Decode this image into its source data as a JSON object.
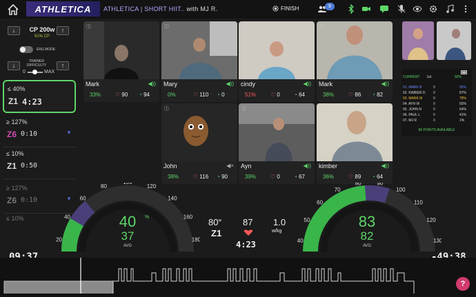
{
  "topbar": {
    "logo": "ATHLETICA",
    "class_title": "ATHLETICA | SHORT HIIT..",
    "instructor": "with MJ R.",
    "finish_label": "FINISH",
    "participant_count": "9"
  },
  "controls": {
    "cp_value": "CP 200w",
    "cp_percent": "91% CP",
    "erg_mode": "ERG MODE",
    "trainer_difficulty": "TRAINER DIFFICULTY",
    "min_label": "0",
    "max_label": "MAX"
  },
  "segments": [
    {
      "pct": "≤ 40%",
      "zone": "Z1",
      "time": "4:23"
    },
    {
      "pct": "≥ 127%",
      "zone": "Z6",
      "time": "0:10"
    },
    {
      "pct": "≤ 10%",
      "zone": "Z1",
      "time": "0:50"
    },
    {
      "pct": "≥ 127%",
      "zone": "Z6",
      "time": "0:10"
    },
    {
      "pct": "≤ 10%",
      "zone": "",
      "time": ""
    }
  ],
  "tiles": [
    {
      "name": "Mark",
      "pct": "33%",
      "hr": "90",
      "cad": "94"
    },
    {
      "name": "Mary",
      "pct": "0%",
      "hr": "110",
      "cad": "0"
    },
    {
      "name": "cindy",
      "pct": "51%",
      "hr": "0",
      "cad": "64"
    },
    {
      "name": "Mark",
      "pct": "38%",
      "hr": "86",
      "cad": "82"
    },
    {
      "name": "John",
      "pct": "38%",
      "hr": "116",
      "cad": "90"
    },
    {
      "name": "Ayn",
      "pct": "39%",
      "hr": "0",
      "cad": "67"
    },
    {
      "name": "kimber",
      "pct": "36%",
      "hr": "89",
      "cad": "64"
    }
  ],
  "leaderboard": {
    "current_label": "CURRENT",
    "place": "1st",
    "pct_label": "92%",
    "rows": [
      {
        "name": "01. MARK B",
        "val": "0",
        "pct": "92%"
      },
      {
        "name": "02. KIMBER D",
        "val": "0",
        "pct": "87%"
      },
      {
        "name": "03. MARK M",
        "val": "0",
        "pct": "78%"
      },
      {
        "name": "04. AYN W",
        "val": "0",
        "pct": "65%"
      },
      {
        "name": "05. JOHN N",
        "val": "0",
        "pct": "64%"
      },
      {
        "name": "06. PAUL L",
        "val": "0",
        "pct": "41%"
      },
      {
        "name": "07. MJ R",
        "val": "0",
        "pct": "1%"
      }
    ],
    "footer": "90 POINTS AVAILABLE"
  },
  "power_gauge": {
    "ticks": [
      "20",
      "40",
      "60",
      "80",
      "100",
      "120",
      "140",
      "160",
      "180"
    ],
    "current": "40",
    "unit": "%",
    "avg": "37",
    "avg_label": "AVG",
    "level_percent": 40
  },
  "cadence_gauge": {
    "ticks": [
      "40",
      "50",
      "60",
      "70",
      "80",
      "90",
      "100",
      "110",
      "120",
      "130"
    ],
    "current": "83",
    "avg": "82",
    "avg_label": "AVG",
    "level_rpm": 83
  },
  "middle": {
    "power": "80",
    "power_unit": "w",
    "zone": "Z1",
    "hr": "87",
    "wkg": "1.0",
    "wkg_unit": "w/kg",
    "interval_time": "4:23"
  },
  "timers": {
    "elapsed": "09:37",
    "remaining": "-49:38"
  },
  "help": "?"
}
